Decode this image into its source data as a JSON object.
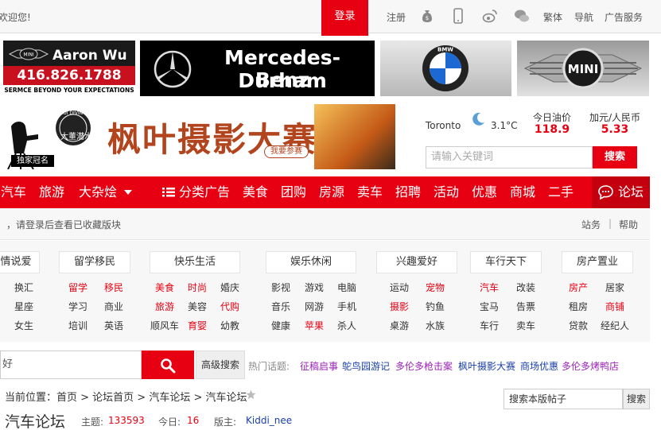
{
  "topbar": {
    "welcome": "欢迎您!",
    "login": "登录",
    "register": "注册",
    "traditional": "繁体",
    "nav": "导航",
    "ads": "广告服务"
  },
  "banners": {
    "aaron_name": "Aaron Wu",
    "aaron_phone": "416.826.1788",
    "aaron_tag": "SERMCE BEYOND YOUR EXPECTATIONS",
    "mini_logo": "MINI",
    "mercedes_line1": "Mercedes-Benz",
    "mercedes_line2": "Durham",
    "bmw_logo": "BMW",
    "mini_logo2": "MINI"
  },
  "photo_banner": {
    "title": "枫叶摄影大赛",
    "join": "我要参赛",
    "sponsor": "独家冠名",
    "sponsor_brand_line1": "大董",
    "sponsor_brand_line2": "潜水",
    "sponsor_brand_en": "RUI DIVING"
  },
  "weather": {
    "city": "Toronto",
    "temp": "3.1°C"
  },
  "oil": {
    "label": "今日油价",
    "value": "118.9"
  },
  "fx": {
    "label": "加元/人民币",
    "value": "5.33"
  },
  "search_top": {
    "placeholder": "请输入关键词",
    "button": "搜索"
  },
  "nav": {
    "items": [
      "汽车",
      "旅游",
      "大杂烩",
      "分类广告",
      "美食",
      "团购",
      "房源",
      "卖车",
      "招聘",
      "活动",
      "优惠",
      "商城",
      "二手"
    ],
    "forum": "论坛"
  },
  "notice": {
    "text": "，请登录后查看已收藏版块",
    "station": "站务",
    "sep": "|",
    "help": "帮助"
  },
  "categories": {
    "heads": [
      "情说爱",
      "留学移民",
      "快乐生活",
      "娱乐休闲",
      "兴趣爱好",
      "车行天下",
      "房产置业"
    ],
    "col1": [
      "换汇",
      "星座",
      "女生"
    ],
    "col2a": [
      "留学",
      "学习",
      "培训"
    ],
    "col2b": [
      "移民",
      "商业",
      "英语"
    ],
    "col3a": [
      "美食",
      "旅游",
      "顺风车"
    ],
    "col3b": [
      "时尚",
      "美容",
      "育婴"
    ],
    "col3c": [
      "婚庆",
      "代购",
      "幼教"
    ],
    "col4a": [
      "影视",
      "音乐",
      "健康"
    ],
    "col4b": [
      "游戏",
      "网游",
      "苹果"
    ],
    "col4c": [
      "电脑",
      "手机",
      "杀人"
    ],
    "col5a": [
      "运动",
      "摄影",
      "桌游"
    ],
    "col5b": [
      "宠物",
      "钓鱼",
      "水族"
    ],
    "col6a": [
      "汽车",
      "宝马",
      "车行"
    ],
    "col6b": [
      "改装",
      "告票",
      "卖车"
    ],
    "col7a": [
      "房产",
      "租房",
      "贷款"
    ],
    "col7b": [
      "居家",
      "商铺",
      "经纪人"
    ]
  },
  "search2": {
    "value": "好",
    "advanced": "高级搜索",
    "hot_label": "热门话题:",
    "hot_topics": [
      "征稿启事",
      "鸵鸟园游记",
      "多伦多枪击案",
      "枫叶摄影大赛",
      "商场优惠",
      "多伦多烤鸭店"
    ]
  },
  "crumb": {
    "text": "当前位置：首页 > 论坛首页 > 汽车论坛 > 汽车论坛",
    "forum_search_value": "搜索本版帖子",
    "forum_search_btn": "搜索"
  },
  "forum": {
    "title": "汽车论坛",
    "topics_label": "主题:",
    "topics": "133593",
    "today_label": "今日:",
    "today": "16",
    "mod_label": "版主:",
    "mod": "Kiddi_nee"
  },
  "colors": {
    "accent": "#e60012",
    "link_red": "#e60012",
    "link_purple": "#9b23b5",
    "link_blue": "#1a3fa8"
  }
}
